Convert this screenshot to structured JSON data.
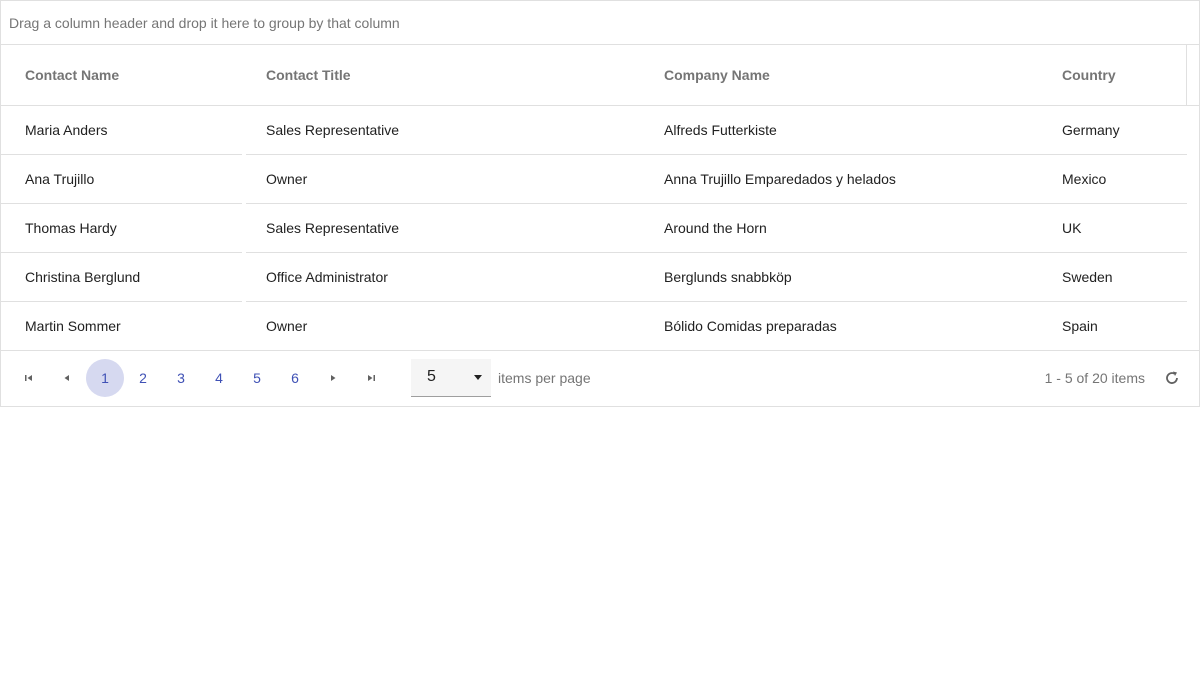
{
  "group_panel": {
    "hint": "Drag a column header and drop it here to group by that column"
  },
  "columns": [
    "Contact Name",
    "Contact Title",
    "Company Name",
    "Country"
  ],
  "rows": [
    [
      "Maria Anders",
      "Sales Representative",
      "Alfreds Futterkiste",
      "Germany"
    ],
    [
      "Ana Trujillo",
      "Owner",
      "Anna Trujillo Emparedados y helados",
      "Mexico"
    ],
    [
      "Thomas Hardy",
      "Sales Representative",
      "Around the Horn",
      "UK"
    ],
    [
      "Christina Berglund",
      "Office Administrator",
      "Berglunds snabbköp",
      "Sweden"
    ],
    [
      "Martin Sommer",
      "Owner",
      "Bólido Comidas preparadas",
      "Spain"
    ]
  ],
  "pager": {
    "pages": [
      "1",
      "2",
      "3",
      "4",
      "5",
      "6"
    ],
    "active_page": "1",
    "page_size": "5",
    "items_per_page_label": "items per page",
    "info": "1 - 5 of 20 items"
  },
  "icons": {
    "first": "first-page-icon",
    "prev": "prev-page-icon",
    "next": "next-page-icon",
    "last": "last-page-icon",
    "dropdown": "caret-down-icon",
    "refresh": "refresh-icon"
  },
  "colors": {
    "accent": "#3f51b5",
    "active_page_bg": "#d6d9f0",
    "border": "#e0e0e0"
  }
}
